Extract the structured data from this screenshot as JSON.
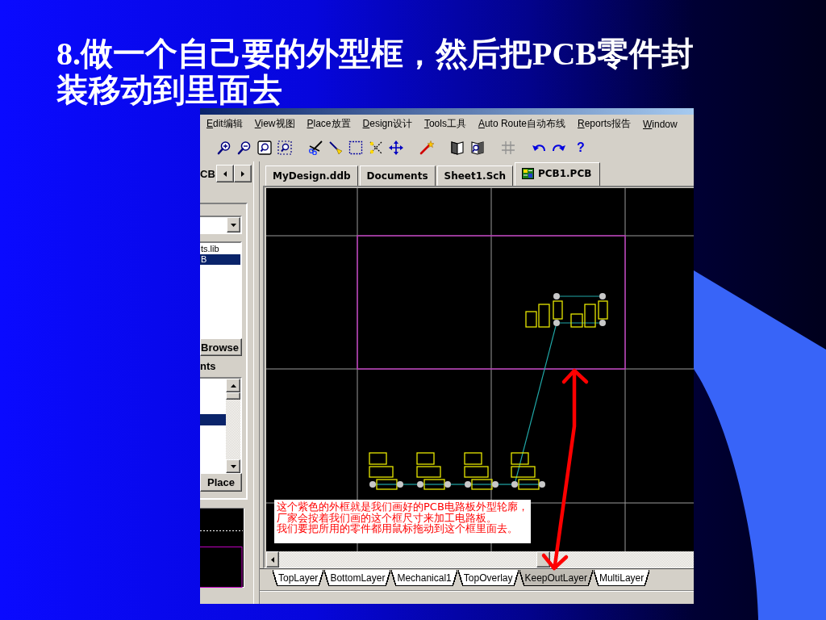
{
  "title": "8.做一个自己要的外型框，然后把PCB零件封装移动到里面去",
  "window": {
    "menu": [
      "Edit编辑",
      "View视图",
      "Place放置",
      "Design设计",
      "Tools工具",
      "Auto Route自动布线",
      "Reports报告",
      "Window"
    ],
    "toolbar": {
      "help": "?"
    }
  },
  "left_panel": {
    "tab_label": "CB",
    "library_list": [
      {
        "text": "ts.lib",
        "selected": false
      },
      {
        "text": "B",
        "selected": true
      }
    ],
    "browse_button": "Browse",
    "list_label": "nts",
    "component_list": [
      {
        "selected": false
      },
      {
        "selected": false
      },
      {
        "selected": false
      },
      {
        "selected": true
      }
    ],
    "place_button": "Place"
  },
  "document_tabs": [
    {
      "label": "MyDesign.ddb",
      "kind": "database",
      "selected": false
    },
    {
      "label": "Documents",
      "kind": "folder",
      "selected": false
    },
    {
      "label": "Sheet1.Sch",
      "kind": "schematic",
      "selected": false
    },
    {
      "label": "PCB1.PCB",
      "kind": "pcb",
      "selected": true
    }
  ],
  "canvas": {
    "note": [
      "这个紫色的外框就是我们画好的PCB电路板外型轮廓，",
      "厂家会按着我们画的这个框尺寸来加工电路板。",
      "我们要把所用的零件都用鼠标拖动到这个框里面去。"
    ]
  },
  "layer_tabs": [
    {
      "label": "TopLayer",
      "selected": false
    },
    {
      "label": "BottomLayer",
      "selected": false
    },
    {
      "label": "Mechanical1",
      "selected": false
    },
    {
      "label": "TopOverlay",
      "selected": false
    },
    {
      "label": "KeepOutLayer",
      "selected": true
    },
    {
      "label": "MultiLayer",
      "selected": false
    }
  ]
}
